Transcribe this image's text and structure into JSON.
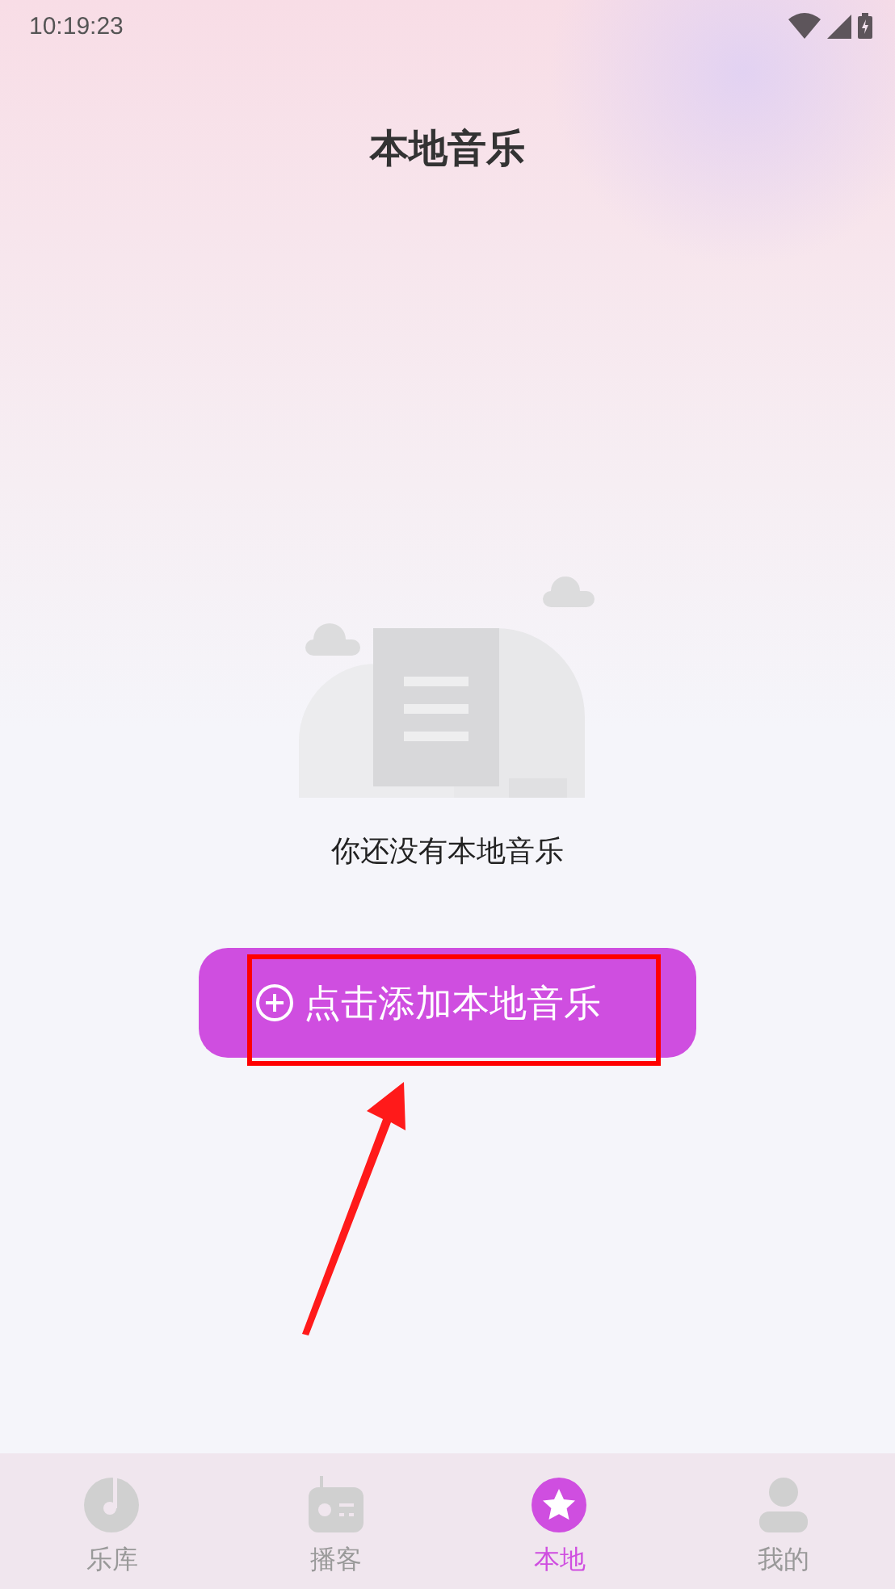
{
  "status_bar": {
    "time": "10:19:23"
  },
  "header": {
    "title": "本地音乐"
  },
  "empty_state": {
    "message": "你还没有本地音乐"
  },
  "add_button": {
    "label": "点击添加本地音乐",
    "highlighted": true
  },
  "annotation": {
    "arrow": true
  },
  "tab_bar": [
    {
      "kind": "disc",
      "label": "乐库",
      "selected": false
    },
    {
      "kind": "radio",
      "label": "播客",
      "selected": false
    },
    {
      "kind": "star",
      "label": "本地",
      "selected": true
    },
    {
      "kind": "person",
      "label": "我的",
      "selected": false
    }
  ]
}
